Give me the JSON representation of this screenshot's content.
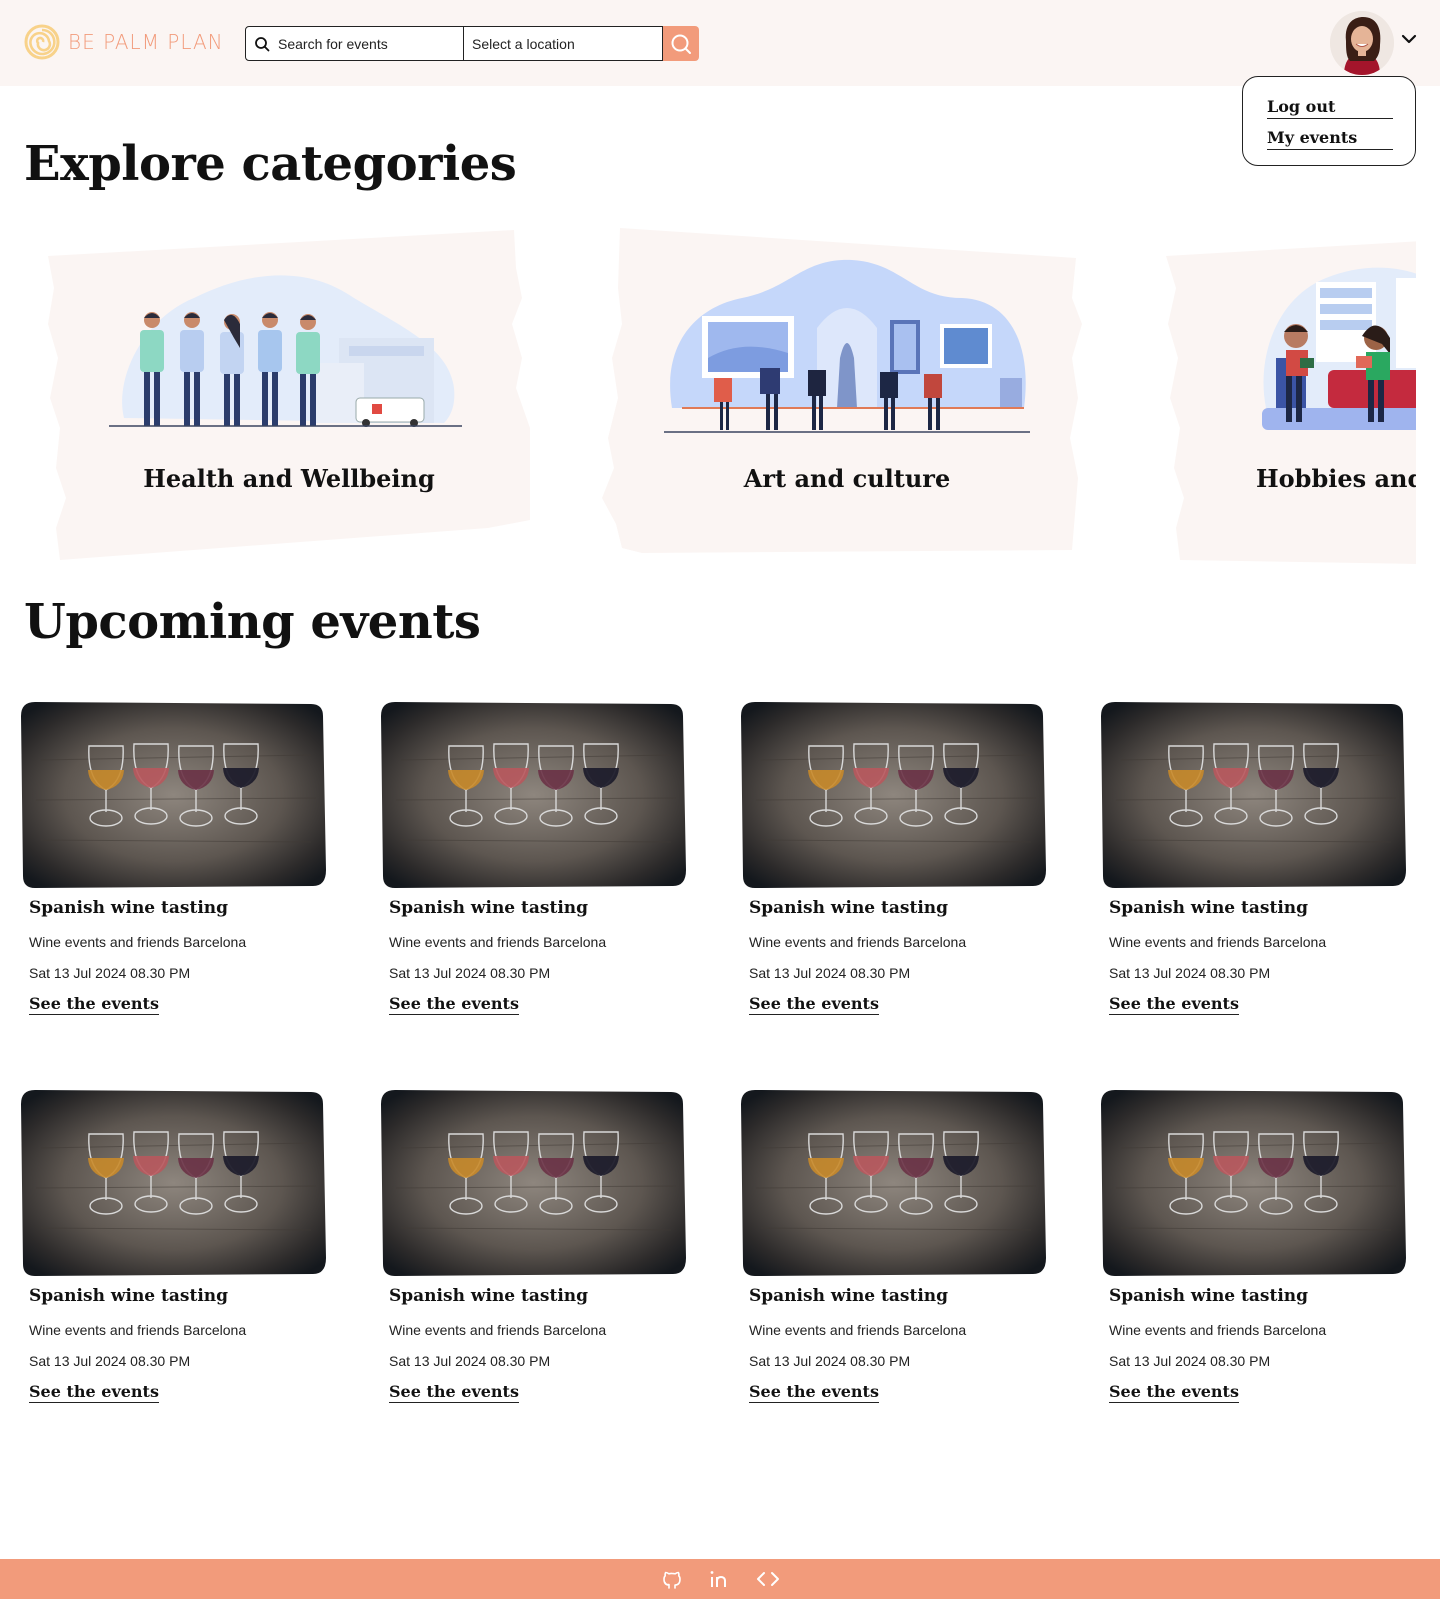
{
  "header": {
    "logo_text": "BE PALM PLAN",
    "search_placeholder": "Search for events",
    "location_placeholder": "Select a location",
    "search_button_icon": "search-icon"
  },
  "user_menu": {
    "avatar_icon": "user-avatar",
    "toggle_icon": "chevron-down-icon",
    "items": [
      {
        "label": "Log out"
      },
      {
        "label": "My events"
      }
    ]
  },
  "categories_section": {
    "heading": "Explore categories",
    "items": [
      {
        "label": "Health and Wellbeing",
        "illustration": "medical-team-illustration"
      },
      {
        "label": "Art and culture",
        "illustration": "art-gallery-illustration"
      },
      {
        "label": "Hobbies and",
        "illustration": "reading-people-illustration"
      }
    ]
  },
  "events_section": {
    "heading": "Upcoming events",
    "events": [
      {
        "title": "Spanish wine tasting",
        "organizer": "Wine events and friends Barcelona",
        "date": "Sat 13 Jul 2024 08.30 PM",
        "link": "See the events"
      },
      {
        "title": "Spanish wine tasting",
        "organizer": "Wine events and friends Barcelona",
        "date": "Sat 13 Jul 2024 08.30 PM",
        "link": "See the events"
      },
      {
        "title": "Spanish wine tasting",
        "organizer": "Wine events and friends Barcelona",
        "date": "Sat 13 Jul 2024 08.30 PM",
        "link": "See the events"
      },
      {
        "title": "Spanish wine tasting",
        "organizer": "Wine events and friends Barcelona",
        "date": "Sat 13 Jul 2024 08.30 PM",
        "link": "See the events"
      },
      {
        "title": "Spanish wine tasting",
        "organizer": "Wine events and friends Barcelona",
        "date": "Sat 13 Jul 2024 08.30 PM",
        "link": "See the events"
      },
      {
        "title": "Spanish wine tasting",
        "organizer": "Wine events and friends Barcelona",
        "date": "Sat 13 Jul 2024 08.30 PM",
        "link": "See the events"
      },
      {
        "title": "Spanish wine tasting",
        "organizer": "Wine events and friends Barcelona",
        "date": "Sat 13 Jul 2024 08.30 PM",
        "link": "See the events"
      },
      {
        "title": "Spanish wine tasting",
        "organizer": "Wine events and friends Barcelona",
        "date": "Sat 13 Jul 2024 08.30 PM",
        "link": "See the events"
      }
    ]
  },
  "footer": {
    "icons": [
      "github-icon",
      "linkedin-icon",
      "code-icon"
    ]
  },
  "colors": {
    "accent": "#f29b7b",
    "header_bg": "#fbf5f3",
    "category_bg": "#fbf5f3",
    "logo_spiral": "#f8d28a"
  }
}
